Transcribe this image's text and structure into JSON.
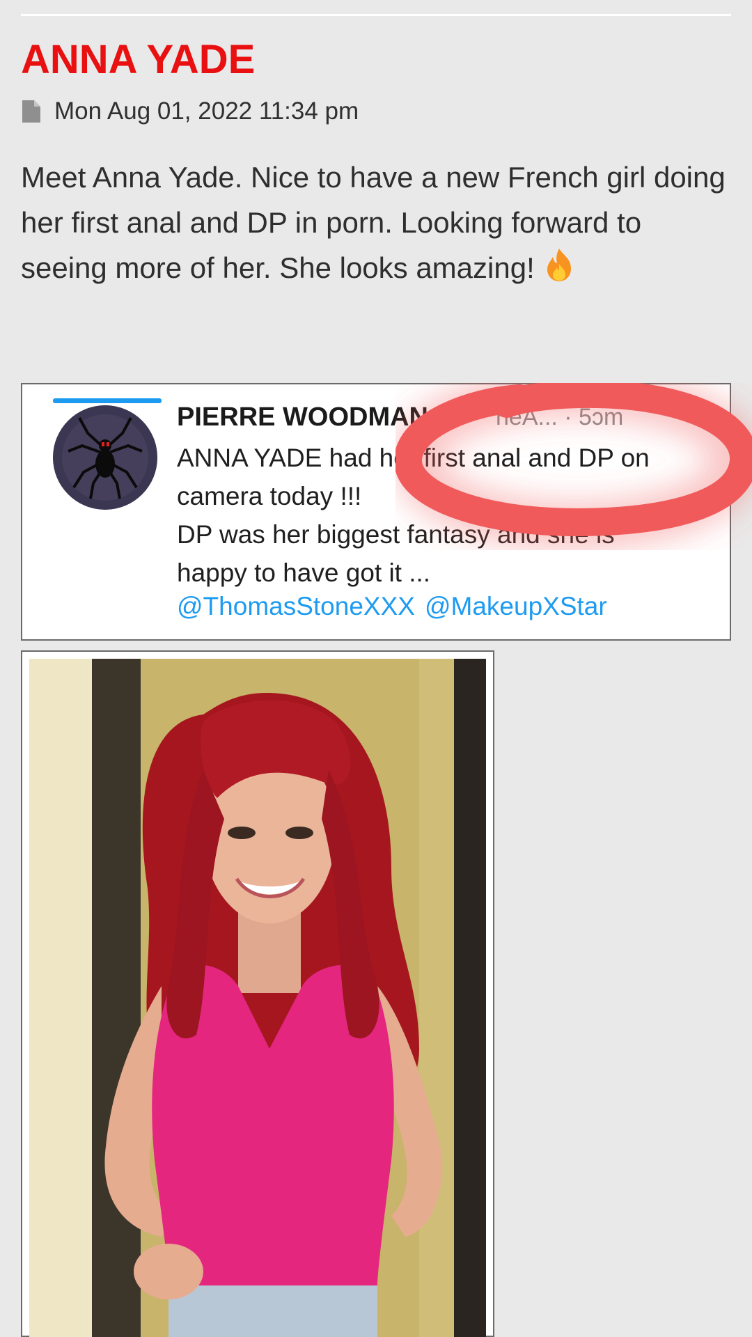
{
  "post": {
    "title": "ANNA YADE",
    "date": "Mon Aug 01, 2022 11:34 pm",
    "body": "Meet Anna Yade. Nice to have a new French girl doing her first anal and DP in porn. Looking forward to seeing more of her. She looks amazing!",
    "emoji_icon": "fire-emoji"
  },
  "tweet": {
    "author": "PIERRE WOODMAN",
    "handle_time": "neA... · 5ɔm",
    "text_lines": [
      "ANNA YADE had her first anal and DP on",
      "camera today !!!",
      "DP was her biggest fantasy and she is",
      "happy to have got it ..."
    ],
    "mention_1": "@ThomasStoneXXX",
    "mention_2": "@MakeupXStar",
    "highlight_color": "#f05a5a",
    "link_color": "#1d9bf0"
  },
  "colors": {
    "title": "#e81010",
    "background": "#e9e9e9"
  }
}
